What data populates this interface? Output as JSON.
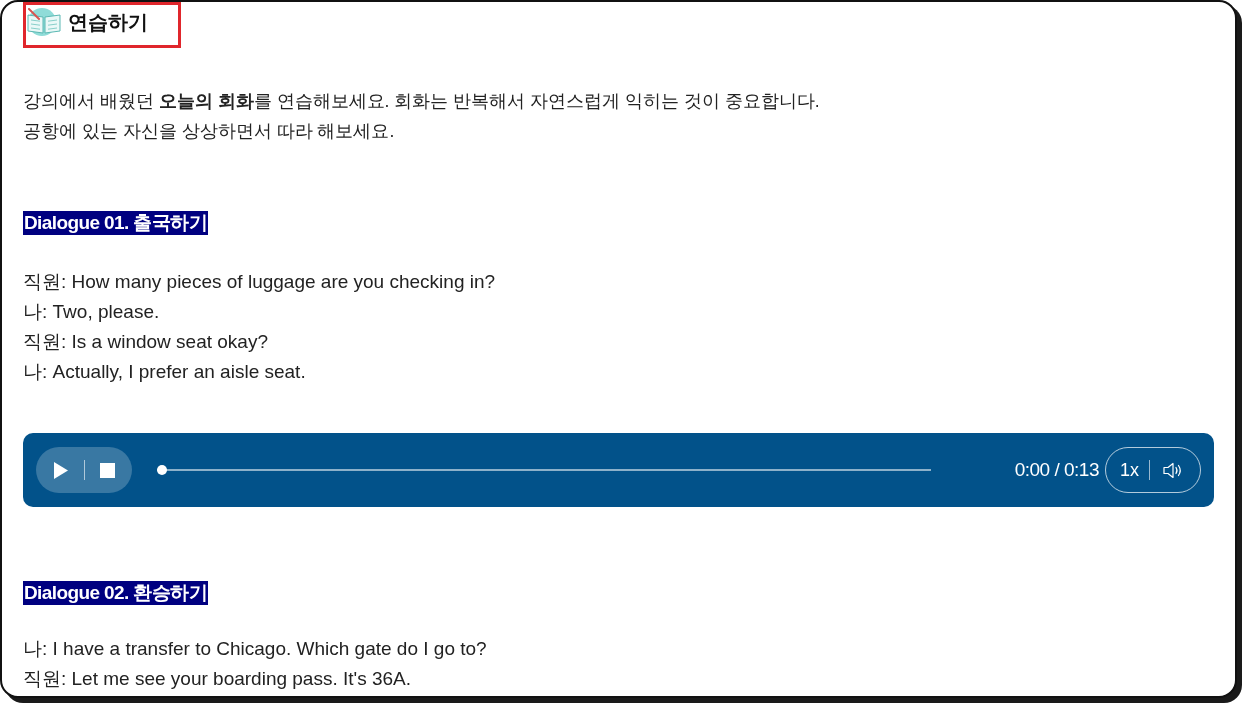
{
  "header": {
    "title": "연습하기",
    "highlighted": true
  },
  "intro": [
    "강의에서 배웠던 **오늘의 회화**를 연습해보세요. 회화는 반복해서 자연스럽게 익히는 것이 중요합니다.",
    "공항에 있는 자신을 상상하면서 따라 해보세요."
  ],
  "dialogues": [
    {
      "heading": "Dialogue 01. 출국하기",
      "lines": [
        "직원: How many pieces of luggage are you checking in?",
        "나: Two, please.",
        "직원: Is a window seat okay?",
        "나: Actually, I prefer an aisle seat."
      ],
      "player": {
        "level": 0,
        "time": "0:00 / 0:13",
        "speed": "1x"
      }
    },
    {
      "heading": "Dialogue 02. 환승하기",
      "lines": [
        "나: I have a transfer to Chicago. Which gate do I go to?",
        "직원: Let me see your boarding pass. It's 36A."
      ]
    }
  ]
}
